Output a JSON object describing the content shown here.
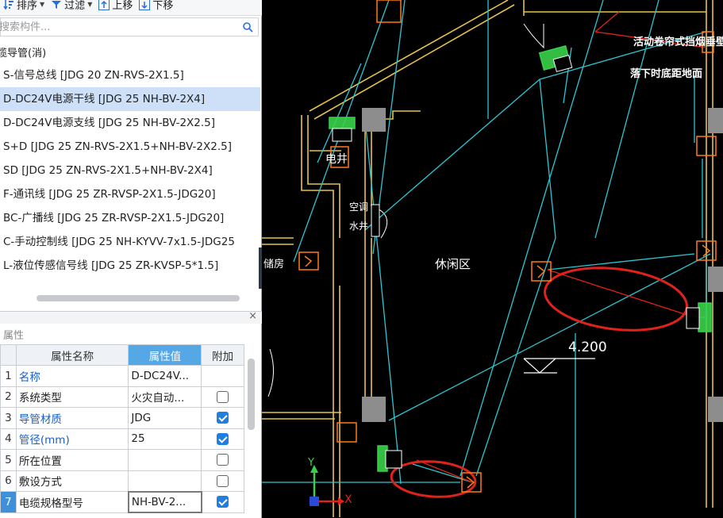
{
  "toolbar": {
    "sort_label": "排序",
    "filter_label": "过滤",
    "move_up_label": "上移",
    "move_down_label": "下移"
  },
  "search": {
    "placeholder": "搜索构件..."
  },
  "tree": {
    "group_label": "缆导管(消)",
    "items": [
      {
        "label": "S-信号总线 [JDG 20 ZN-RVS-2X1.5]",
        "selected": false
      },
      {
        "label": "D-DC24V电源干线 [JDG 25 NH-BV-2X4]",
        "selected": true
      },
      {
        "label": "D-DC24V电源支线 [JDG 25 NH-BV-2X2.5]",
        "selected": false
      },
      {
        "label": "S+D [JDG 25 ZN-RVS-2X1.5+NH-BV-2X2.5]",
        "selected": false
      },
      {
        "label": "SD [JDG 25 ZN-RVS-2X1.5+NH-BV-2X4]",
        "selected": false
      },
      {
        "label": "F-通讯线 [JDG 25 ZR-RVSP-2X1.5-JDG20]",
        "selected": false
      },
      {
        "label": "BC-广播线 [JDG 25 ZR-RVSP-2X1.5-JDG20]",
        "selected": false
      },
      {
        "label": "C-手动控制线 [JDG 25 NH-KYVV-7x1.5-JDG25",
        "selected": false
      },
      {
        "label": "L-液位传感信号线 [JDG 25 ZR-KVSP-5*1.5]",
        "selected": false
      }
    ]
  },
  "properties": {
    "title": "属性",
    "close_label": "×",
    "headers": {
      "name": "属性名称",
      "value": "属性值",
      "extra": "附加"
    },
    "rows": [
      {
        "num": "1",
        "name": "名称",
        "value": "D-DC24V...",
        "blue": true,
        "checkbox": "none"
      },
      {
        "num": "2",
        "name": "系统类型",
        "value": "火灾自动...",
        "blue": false,
        "checkbox": "off"
      },
      {
        "num": "3",
        "name": "导管材质",
        "value": "JDG",
        "blue": true,
        "checkbox": "on"
      },
      {
        "num": "4",
        "name": "管径(mm)",
        "value": "25",
        "blue": true,
        "checkbox": "on"
      },
      {
        "num": "5",
        "name": "所在位置",
        "value": "",
        "blue": false,
        "checkbox": "off"
      },
      {
        "num": "6",
        "name": "敷设方式",
        "value": "",
        "blue": false,
        "checkbox": "off"
      },
      {
        "num": "7",
        "name": "电缆规格型号",
        "value": "NH-BV-2...",
        "blue": false,
        "checkbox": "on",
        "selected": true
      }
    ]
  },
  "drawing": {
    "label_shutter": "活动卷帘式挡烟垂壁",
    "label_floor": "落下时底距地面",
    "label_well": "电井",
    "label_ac_1": "空调",
    "label_ac_2": "水井",
    "label_room": "休闲区",
    "label_left": "储房",
    "label_elev": "4.200",
    "axis_y": "Y",
    "axis_x": "X",
    "colors": {
      "wall": "#e8c24a",
      "wire": "#2cc7d4",
      "highlight": "#e0221c",
      "device": "#ff7a1a",
      "green": "#38d24a"
    }
  }
}
